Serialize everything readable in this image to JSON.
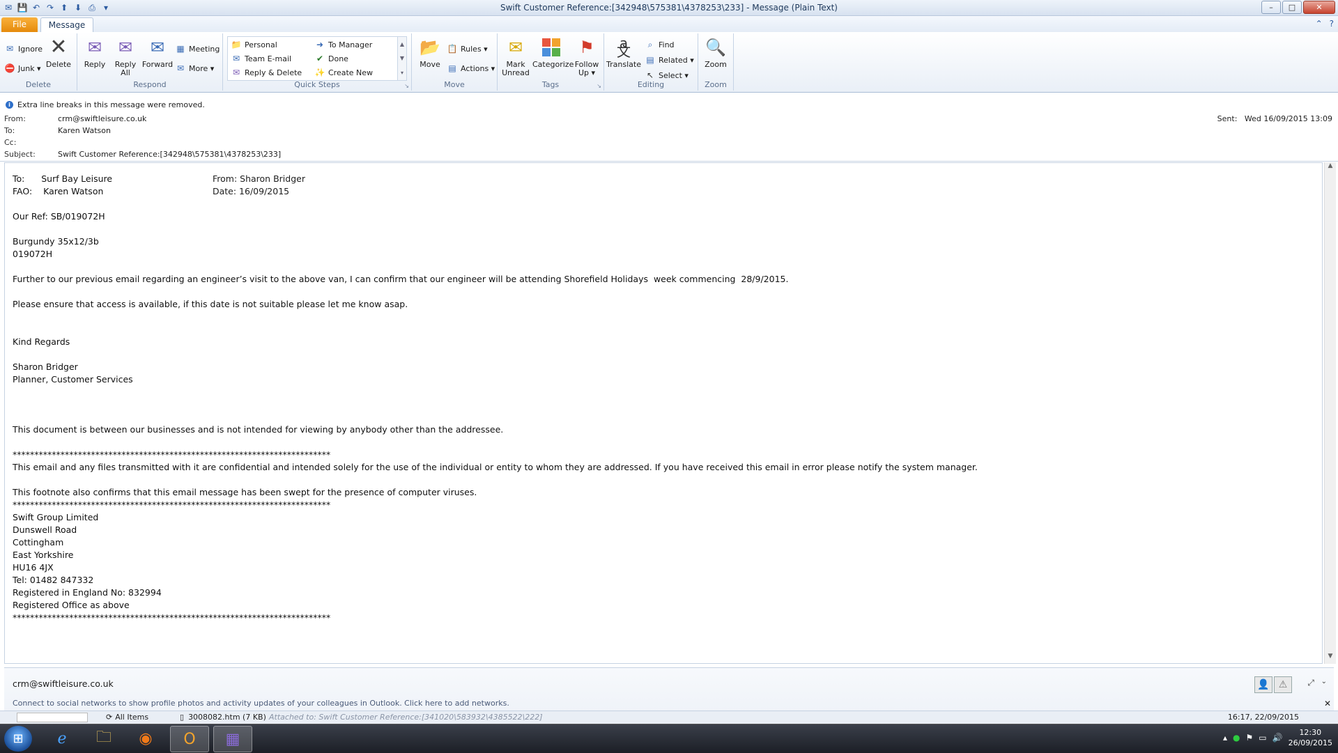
{
  "window": {
    "title": "Swift Customer Reference:[342948\\575381\\4378253\\233]  -  Message (Plain Text)",
    "controls": {
      "minimize": "–",
      "maximize": "□",
      "close": "✕"
    }
  },
  "tabs": {
    "file": "File",
    "message": "Message"
  },
  "ribbon": {
    "delete": {
      "label": "Delete",
      "ignore": "Ignore",
      "junk": "Junk ▾",
      "delete": "Delete"
    },
    "respond": {
      "label": "Respond",
      "reply": "Reply",
      "reply_all_1": "Reply",
      "reply_all_2": "All",
      "forward": "Forward",
      "meeting": "Meeting",
      "more": "More ▾"
    },
    "quick_steps": {
      "label": "Quick Steps",
      "items": [
        "Personal",
        "To Manager",
        "Team E-mail",
        "Done",
        "Reply & Delete",
        "Create New"
      ]
    },
    "move": {
      "label": "Move",
      "move": "Move",
      "rules": "Rules ▾",
      "actions": "Actions ▾"
    },
    "tags": {
      "label": "Tags",
      "mark_unread_1": "Mark",
      "mark_unread_2": "Unread",
      "categorize": "Categorize",
      "follow_up_1": "Follow",
      "follow_up_2": "Up ▾"
    },
    "editing": {
      "label": "Editing",
      "translate": "Translate",
      "find": "Find",
      "related": "Related ▾",
      "select": "Select ▾"
    },
    "zoom": {
      "label": "Zoom",
      "zoom": "Zoom"
    }
  },
  "header": {
    "info": "Extra line breaks in this message were removed.",
    "from_label": "From:",
    "from": "crm@swiftleisure.co.uk",
    "to_label": "To:",
    "to": "Karen Watson",
    "cc_label": "Cc:",
    "cc": "",
    "subject_label": "Subject:",
    "subject": "Swift Customer Reference:[342948\\575381\\4378253\\233]",
    "sent_label": "Sent:",
    "sent": "Wed 16/09/2015 13:09"
  },
  "body": {
    "to_line": "To:      Surf Bay Leisure",
    "fao_line": "FAO:    Karen Watson",
    "from_line": "From: Sharon Bridger",
    "date_line": "Date:  16/09/2015",
    "lines": [
      "",
      "Our Ref: SB/019072H",
      "",
      "Burgundy 35x12/3b",
      "019072H",
      "",
      "Further to our previous email regarding an engineer’s visit to the above van, I can confirm that our engineer will be attending Shorefield Holidays  week commencing  28/9/2015.",
      "",
      "Please ensure that access is available, if this date is not suitable please let me know asap.",
      "",
      "",
      "Kind Regards",
      "",
      "Sharon Bridger",
      "Planner, Customer Services",
      "",
      "",
      "",
      "This document is between our businesses and is not intended for viewing by anybody other than the addressee.",
      "",
      "*************************************************************************",
      "This email and any files transmitted with it are confidential and intended solely for the use of the individual or entity to whom they are addressed. If you have received this email in error please notify the system manager.",
      "",
      "This footnote also confirms that this email message has been swept for the presence of computer viruses.",
      "*************************************************************************",
      "Swift Group Limited",
      "Dunswell Road",
      "Cottingham",
      "East Yorkshire",
      "HU16 4JX",
      "Tel: 01482 847332",
      "Registered in England No: 832994",
      "Registered Office as above",
      "*************************************************************************"
    ]
  },
  "people_pane": {
    "who": "crm@swiftleisure.co.uk",
    "message": "Connect to social networks to show profile photos and activity updates of your colleagues in Outlook. Click here to add networks."
  },
  "statusbar": {
    "all_items": "All Items",
    "attachment": "3008082.htm (7 KB)",
    "attached_to": "Attached to: Swift Customer Reference:[341020\\583932\\4385522\\222]",
    "date": "16:17, 22/09/2015"
  },
  "taskbar": {
    "time": "12:30",
    "date": "26/09/2015"
  }
}
